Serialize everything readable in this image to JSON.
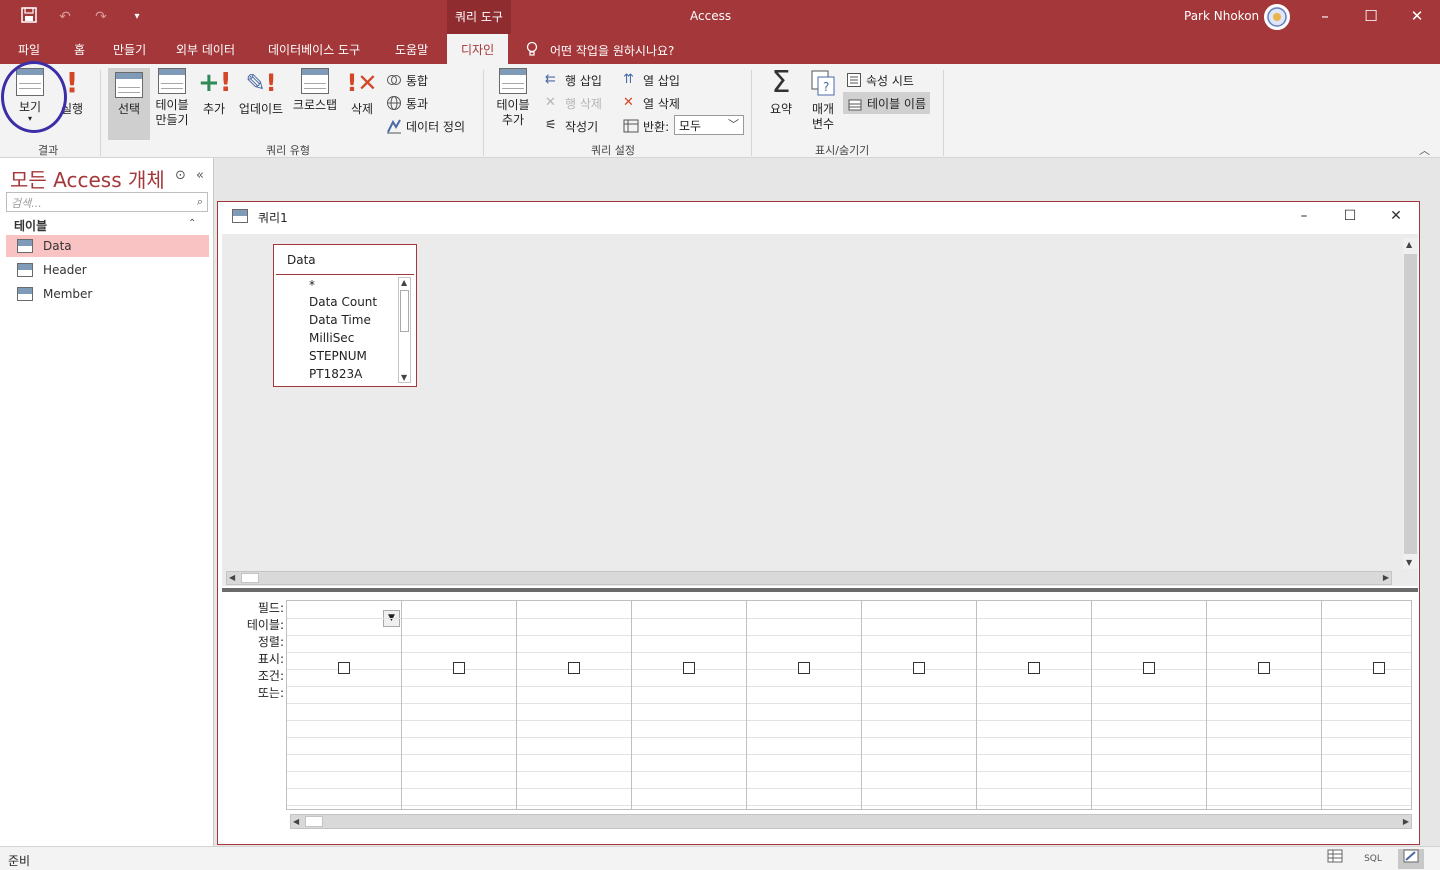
{
  "titlebar": {
    "context_tools": "쿼리 도구",
    "app_title": "Access",
    "user_name": "Park Nhokon"
  },
  "menu": {
    "tabs": [
      "파일",
      "홈",
      "만들기",
      "외부 데이터",
      "데이터베이스 도구",
      "도움말",
      "디자인"
    ],
    "tell_me": "어떤 작업을 원하시나요?"
  },
  "ribbon": {
    "results": {
      "label": "결과",
      "view": "보기",
      "run": "실행"
    },
    "query_type": {
      "label": "쿼리 유형",
      "select": "선택",
      "make_table_1": "테이블",
      "make_table_2": "만들기",
      "append": "추가",
      "update": "업데이트",
      "crosstab": "크로스탭",
      "delete": "삭제",
      "union": "통합",
      "pass_through": "통과",
      "data_definition": "데이터 정의"
    },
    "query_setup": {
      "label": "쿼리 설정",
      "show_table_1": "테이블",
      "show_table_2": "추가",
      "insert_rows": "행 삽입",
      "delete_rows": "행 삭제",
      "builder": "작성기",
      "insert_columns": "열 삽입",
      "delete_columns": "열 삭제",
      "return_label": "반환:",
      "return_value": "모두"
    },
    "show_hide": {
      "label": "표시/숨기기",
      "totals": "요약",
      "parameters_1": "매개",
      "parameters_2": "변수",
      "property_sheet": "속성 시트",
      "table_names": "테이블 이름"
    }
  },
  "nav": {
    "title": "모든 Access 개체",
    "search_placeholder": "검색...",
    "group": "테이블",
    "items": [
      "Data",
      "Header",
      "Member"
    ]
  },
  "query_window": {
    "title": "쿼리1",
    "field_list": {
      "table": "Data",
      "fields": [
        "*",
        "Data Count",
        "Data Time",
        "MilliSec",
        "STEPNUM",
        "PT1823A"
      ]
    },
    "row_labels": [
      "필드:",
      "테이블:",
      "정렬:",
      "표시:",
      "조건:",
      "또는:"
    ]
  },
  "status": {
    "text": "준비",
    "views": [
      "datasheet-view",
      "SQL",
      "design-view"
    ]
  },
  "colors": {
    "accent": "#a4373a",
    "annotation": "#3b2ea6"
  }
}
